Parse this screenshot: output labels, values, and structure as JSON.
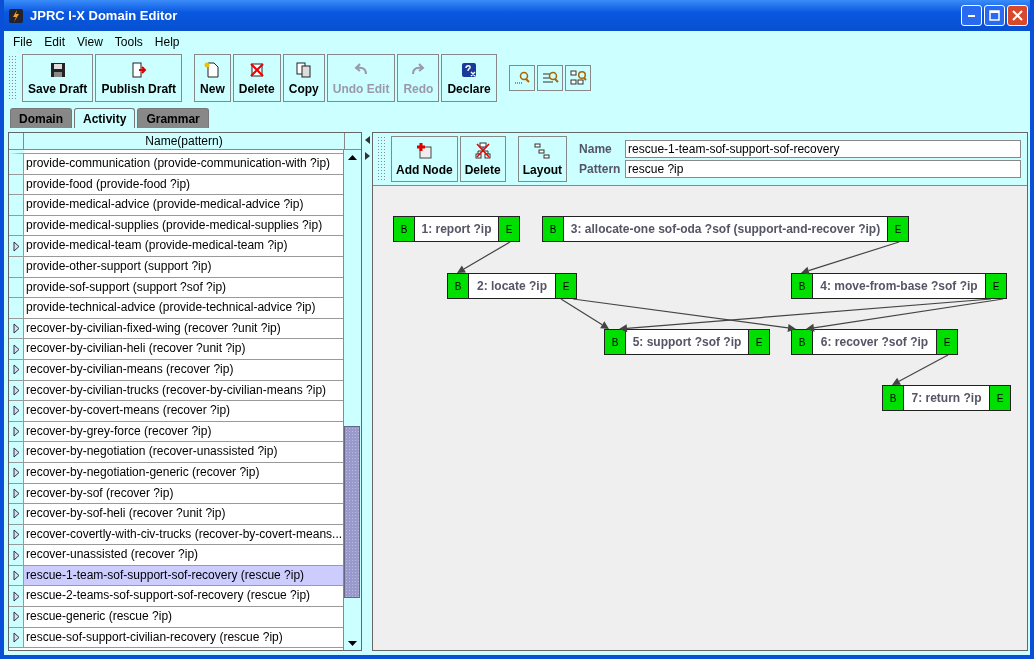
{
  "window": {
    "title": "JPRC I-X Domain Editor"
  },
  "menu": [
    "File",
    "Edit",
    "View",
    "Tools",
    "Help"
  ],
  "toolbar": [
    {
      "kind": "save",
      "label": "Save Draft",
      "disabled": false
    },
    {
      "kind": "publish",
      "label": "Publish Draft",
      "disabled": false
    },
    {
      "kind": "new",
      "label": "New",
      "disabled": false
    },
    {
      "kind": "delete",
      "label": "Delete",
      "disabled": false
    },
    {
      "kind": "copy",
      "label": "Copy",
      "disabled": false
    },
    {
      "kind": "undo",
      "label": "Undo Edit",
      "disabled": true
    },
    {
      "kind": "redo",
      "label": "Redo",
      "disabled": true
    },
    {
      "kind": "declare",
      "label": "Declare",
      "disabled": false
    }
  ],
  "tabs": [
    {
      "label": "Domain",
      "selected": false
    },
    {
      "label": "Activity",
      "selected": true
    },
    {
      "label": "Grammar",
      "selected": false
    }
  ],
  "table": {
    "columns": [
      "Name(pattern)"
    ],
    "rows": [
      {
        "text": "provide-communication (provide-communication-with ?ip)",
        "expandable": false,
        "selected": false
      },
      {
        "text": "provide-food (provide-food ?ip)",
        "expandable": false,
        "selected": false
      },
      {
        "text": "provide-medical-advice (provide-medical-advice ?ip)",
        "expandable": false,
        "selected": false
      },
      {
        "text": "provide-medical-supplies (provide-medical-supplies ?ip)",
        "expandable": false,
        "selected": false
      },
      {
        "text": "provide-medical-team (provide-medical-team ?ip)",
        "expandable": true,
        "selected": false
      },
      {
        "text": "provide-other-support (support ?ip)",
        "expandable": false,
        "selected": false
      },
      {
        "text": "provide-sof-support (support ?sof ?ip)",
        "expandable": false,
        "selected": false
      },
      {
        "text": "provide-technical-advice (provide-technical-advice ?ip)",
        "expandable": false,
        "selected": false
      },
      {
        "text": "recover-by-civilian-fixed-wing (recover ?unit ?ip)",
        "expandable": true,
        "selected": false
      },
      {
        "text": "recover-by-civilian-heli (recover ?unit ?ip)",
        "expandable": true,
        "selected": false
      },
      {
        "text": "recover-by-civilian-means (recover ?ip)",
        "expandable": true,
        "selected": false
      },
      {
        "text": "recover-by-civilian-trucks (recover-by-civilian-means ?ip)",
        "expandable": true,
        "selected": false
      },
      {
        "text": "recover-by-covert-means (recover ?ip)",
        "expandable": true,
        "selected": false
      },
      {
        "text": "recover-by-grey-force (recover ?ip)",
        "expandable": true,
        "selected": false
      },
      {
        "text": "recover-by-negotiation (recover-unassisted ?ip)",
        "expandable": true,
        "selected": false
      },
      {
        "text": "recover-by-negotiation-generic (recover ?ip)",
        "expandable": true,
        "selected": false
      },
      {
        "text": "recover-by-sof (recover ?ip)",
        "expandable": true,
        "selected": false
      },
      {
        "text": "recover-by-sof-heli (recover ?unit ?ip)",
        "expandable": true,
        "selected": false
      },
      {
        "text": "recover-covertly-with-civ-trucks (recover-by-covert-means...",
        "expandable": true,
        "selected": false
      },
      {
        "text": "recover-unassisted (recover ?ip)",
        "expandable": true,
        "selected": false
      },
      {
        "text": "rescue-1-team-sof-support-sof-recovery (rescue ?ip)",
        "expandable": true,
        "selected": true
      },
      {
        "text": "rescue-2-teams-sof-support-sof-recovery (rescue ?ip)",
        "expandable": true,
        "selected": false
      },
      {
        "text": "rescue-generic (rescue ?ip)",
        "expandable": true,
        "selected": false
      },
      {
        "text": "rescue-sof-support-civilian-recovery (rescue ?ip)",
        "expandable": true,
        "selected": false
      }
    ]
  },
  "editor": {
    "buttons": [
      {
        "kind": "add",
        "label": "Add Node"
      },
      {
        "kind": "delete",
        "label": "Delete"
      },
      {
        "kind": "layout",
        "label": "Layout"
      }
    ],
    "name_label": "Name",
    "name": "rescue-1-team-sof-support-sof-recovery",
    "pattern_label": "Pattern",
    "pattern": "rescue ?ip",
    "nodes": [
      {
        "begin": "B",
        "label": "1: report ?ip",
        "end": "E"
      },
      {
        "begin": "B",
        "label": "2: locate ?ip",
        "end": "E"
      },
      {
        "begin": "B",
        "label": "3: allocate-one sof-oda ?sof (support-and-recover ?ip)",
        "end": "E"
      },
      {
        "begin": "B",
        "label": "4: move-from-base ?sof ?ip",
        "end": "E"
      },
      {
        "begin": "B",
        "label": "5: support ?sof ?ip",
        "end": "E"
      },
      {
        "begin": "B",
        "label": "6: recover ?sof ?ip",
        "end": "E"
      },
      {
        "begin": "B",
        "label": "7: return ?ip",
        "end": "E"
      }
    ]
  }
}
